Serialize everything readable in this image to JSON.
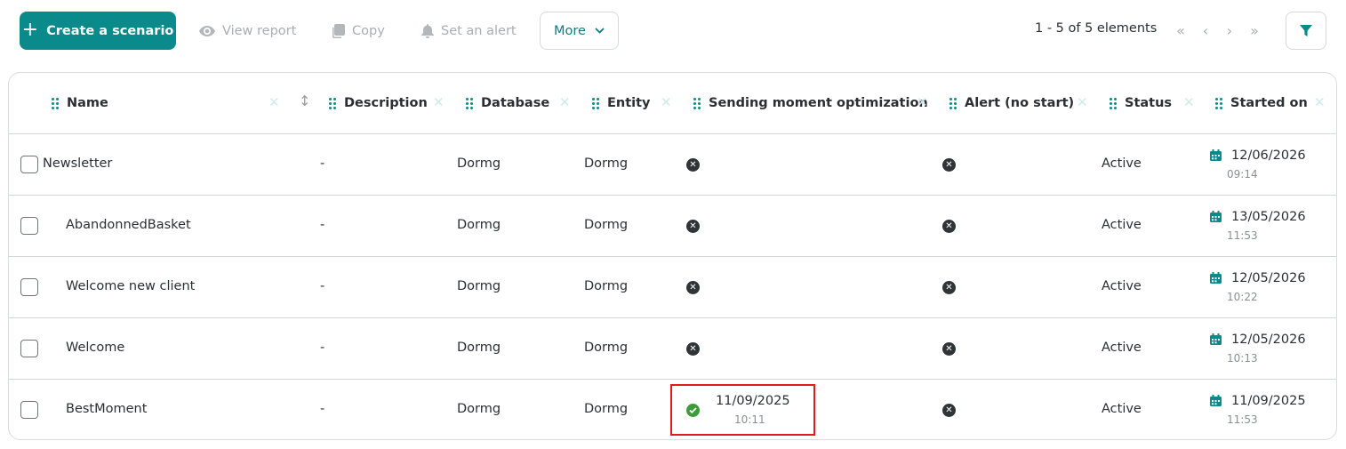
{
  "toolbar": {
    "create_label": "Create a scenario",
    "view_report_label": "View report",
    "copy_label": "Copy",
    "set_alert_label": "Set an alert",
    "more_label": "More",
    "pagination_text": "1 - 5 of 5 elements"
  },
  "colors": {
    "accent": "#0a8a8a",
    "success": "#3d9c3a",
    "highlight": "#e01b1b"
  },
  "table": {
    "columns": [
      "Name",
      "Description",
      "Database",
      "Entity",
      "Sending moment optimization",
      "Alert (no start)",
      "Status",
      "Started on"
    ],
    "rows": [
      {
        "name": "Newsletter",
        "description": "-",
        "database": "Dormg",
        "entity": "Dormg",
        "optimization": "no",
        "alert": "no",
        "status": "Active",
        "started_date": "12/06/2026",
        "started_time": "09:14"
      },
      {
        "name": "AbandonnedBasket",
        "description": "-",
        "database": "Dormg",
        "entity": "Dormg",
        "optimization": "no",
        "alert": "no",
        "status": "Active",
        "started_date": "13/05/2026",
        "started_time": "11:53"
      },
      {
        "name": "Welcome new client",
        "description": "-",
        "database": "Dormg",
        "entity": "Dormg",
        "optimization": "no",
        "alert": "no",
        "status": "Active",
        "started_date": "12/05/2026",
        "started_time": "10:22"
      },
      {
        "name": "Welcome",
        "description": "-",
        "database": "Dormg",
        "entity": "Dormg",
        "optimization": "no",
        "alert": "no",
        "status": "Active",
        "started_date": "12/05/2026",
        "started_time": "10:13"
      },
      {
        "name": "BestMoment",
        "description": "-",
        "database": "Dormg",
        "entity": "Dormg",
        "optimization": "yes",
        "optimization_date": "11/09/2025",
        "optimization_time": "10:11",
        "alert": "no",
        "status": "Active",
        "started_date": "11/09/2025",
        "started_time": "11:53"
      }
    ]
  }
}
